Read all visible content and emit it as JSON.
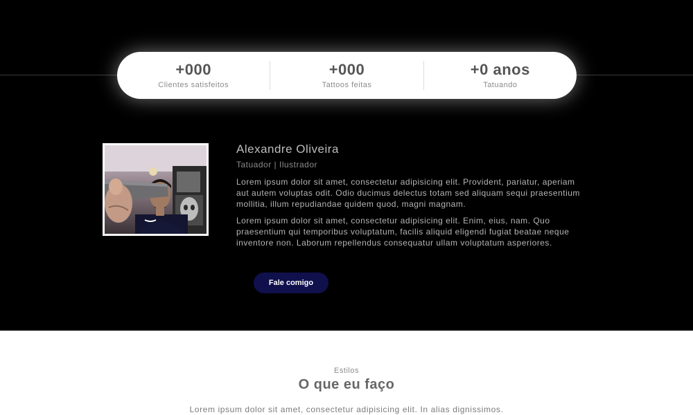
{
  "stats": [
    {
      "value": "+000",
      "label": "Clientes satisfeitos"
    },
    {
      "value": "+000",
      "label": "Tattoos feitas"
    },
    {
      "value": "+0 anos",
      "label": "Tatuando"
    }
  ],
  "about": {
    "name": "Alexandre Oliveira",
    "role": "Tatuador | Ilustrador",
    "paragraph1": "Lorem ipsum dolor sit amet, consectetur adipisicing elit. Provident, pariatur, aperiam aut autem voluptas odit. Odio ducimus delectus totam sed aliquam sequi praesentium mollitia, illum repudiandae quidem quod, magni magnam.",
    "paragraph2": "Lorem ipsum dolor sit amet, consectetur adipisicing elit. Enim, eius, nam. Quo praesentium qui temporibus voluptatum, facilis aliquid eligendi fugiat beatae neque inventore non. Laborum repellendus consequatur ullam voluptatum asperiores.",
    "button_label": "Fale comigo"
  },
  "styles_section": {
    "eyebrow": "Estilos",
    "title": "O que eu faço",
    "description": "Lorem ipsum dolor sit amet, consectetur adipisicing elit. In alias dignissimos."
  },
  "colors": {
    "background_dark": "#000000",
    "button_bg": "#10104d",
    "stats_pill_bg": "#ffffff"
  }
}
